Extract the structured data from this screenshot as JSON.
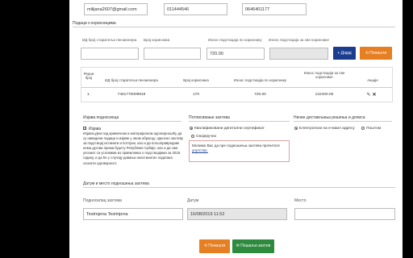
{
  "contact": {
    "email": "milijana2607@gmail.com",
    "phone1": "011444546",
    "phone2": "0646401177"
  },
  "user_data": {
    "section_title": "Подаци о корисницима",
    "id_label": "ИД број старатеља пензионера",
    "number_label": "Број корисника",
    "amount_label": "Износ подстицаја по кориснику",
    "total_label": "Износ подстицаја за све кориснике",
    "id_value": "",
    "number_value": "",
    "amount_value": "720.00",
    "total_value": "",
    "add_button": "+ Додај",
    "reset_button": "Поништи"
  },
  "table": {
    "headers": [
      "Редни број",
      "ИД број старатеља пензионера",
      "Број корисника",
      "Износ подстицаја по кориснику",
      "Износ подстицаја за све кориснике",
      "Акције"
    ],
    "rows": [
      {
        "num": "1.",
        "id": "7461770009919",
        "count": "170",
        "amount": "720.00",
        "total": "122400.00"
      }
    ]
  },
  "statement": {
    "title": "Изјава подносиоца",
    "checkbox_label": "Изјава",
    "text": "Изјављујем под кривичном и материјалном одговорношћу да су наведени подаци и изјаве у овом обрасцу, односно захтеву за подстицај истинити и потпуни, као и да пољопривредник нема дугова према буџету Републике Србије, као и да сам упознат са условима из правилника о подстицајима за 2019. годину, и да ће у случају давања неистинитих података сносити одговорност."
  },
  "signing": {
    "title": "Потписивање захтева",
    "opt1": "Квалификовани дигитални сертификат",
    "opt2": "Својеручно",
    "note_text": "Молимо Вас да пре подношења захтева прочитате",
    "note_link": "упутство."
  },
  "delivery": {
    "title": "Начин достављања решења и дописа",
    "opt1": "Електронски на е-маил адресу",
    "opt2": "Поштом"
  },
  "date_place": {
    "section_title": "Датум и место подношења захтева",
    "submitter_label": "Подносилац захтева",
    "submitter_value": "Testmjena Testmjena",
    "date_label": "Датум",
    "date_value": "16/08/2019 11:52",
    "place_label": "Место",
    "place_value": ""
  },
  "actions": {
    "cancel": "Поништи",
    "submit": "Пошаљи захтев"
  },
  "colors": {
    "blue": "#1b3d8f",
    "orange": "#e67e22",
    "green": "#2e8b3e"
  }
}
